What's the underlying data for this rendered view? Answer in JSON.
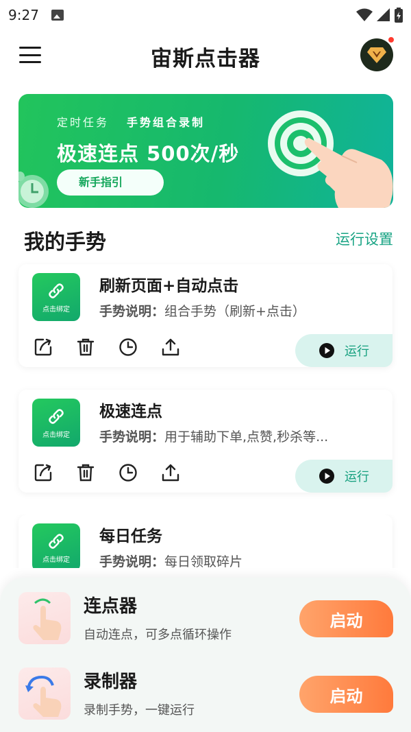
{
  "status_bar": {
    "time": "9:27"
  },
  "header": {
    "title": "宙斯点击器"
  },
  "banner": {
    "tag_timer": "定时任务",
    "tag_gesture": "手势组合录制",
    "headline": "极速连点 500次/秒",
    "guide_label": "新手指引"
  },
  "section": {
    "title": "我的手势",
    "settings_label": "运行设置"
  },
  "gestures": [
    {
      "name": "刷新页面+自动点击",
      "desc_label": "手势说明：",
      "desc": "组合手势（刷新+点击）",
      "bind_label": "点击绑定",
      "run_label": "运行"
    },
    {
      "name": "极速连点",
      "desc_label": "手势说明：",
      "desc": "用于辅助下单,点赞,秒杀等...",
      "bind_label": "点击绑定",
      "run_label": "运行"
    },
    {
      "name": "每日任务",
      "desc_label": "手势说明：",
      "desc": "每日领取碎片",
      "bind_label": "点击绑定"
    }
  ],
  "tools": [
    {
      "name": "连点器",
      "desc": "自动连点，可多点循环操作",
      "start_label": "启动"
    },
    {
      "name": "录制器",
      "desc": "录制手势，一键运行",
      "start_label": "启动"
    }
  ],
  "colors": {
    "brand_green": "#16b86e",
    "accent_teal": "#17a383",
    "start_orange": "#ff7a3c"
  }
}
